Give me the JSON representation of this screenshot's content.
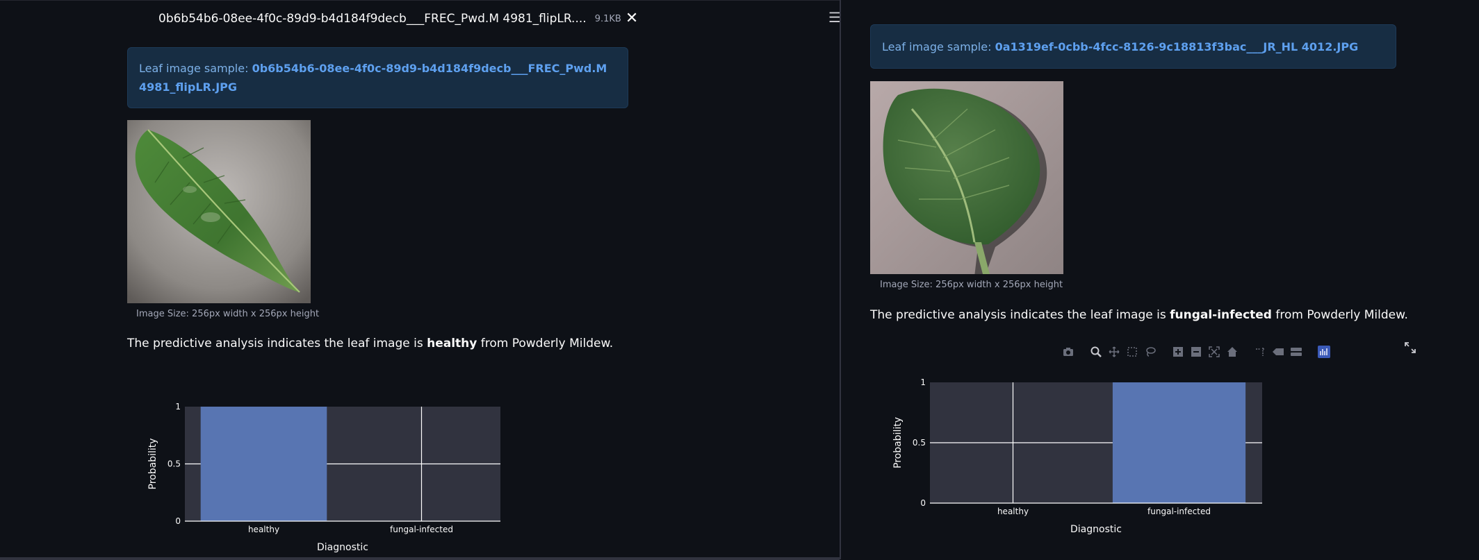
{
  "left_pane": {
    "file": {
      "name": "0b6b54b6-08ee-4f0c-89d9-b4d184f9decb___FREC_Pwd.M 4981_flipLR....",
      "size": "9.1KB",
      "close_icon": "close-icon",
      "file_icon": "file-icon"
    },
    "menu_icon": "hamburger-menu-icon",
    "info_prefix": "Leaf image sample: ",
    "info_filename": "0b6b54b6-08ee-4f0c-89d9-b4d184f9decb___FREC_Pwd.M 4981_flipLR.JPG",
    "image_caption": "Image Size: 256px width x 256px height",
    "analysis": {
      "prefix": "The predictive analysis indicates the leaf image is ",
      "result": "healthy",
      "suffix": " from Powderly Mildew."
    }
  },
  "right_pane": {
    "info_prefix": "Leaf image sample: ",
    "info_filename": "0a1319ef-0cbb-4fcc-8126-9c18813f3bac___JR_HL 4012.JPG",
    "image_caption": "Image Size: 256px width x 256px height",
    "analysis": {
      "prefix": "The predictive analysis indicates the leaf image is ",
      "result": "fungal-infected",
      "suffix": " from Powderly Mildew."
    },
    "modebar_icons": [
      "camera-icon",
      "zoom-icon",
      "pan-icon",
      "box-select-icon",
      "lasso-select-icon",
      "zoom-in-icon",
      "zoom-out-icon",
      "autoscale-icon",
      "reset-axes-icon",
      "spike-lines-icon",
      "hover-closest-icon",
      "hover-compare-icon",
      "plotly-logo-icon"
    ],
    "expand_icon": "fullscreen-icon"
  },
  "colors": {
    "background": "#0e1117",
    "plot_bg": "#31333f",
    "bar": "#5875b2",
    "info_bg": "#172d43",
    "info_link": "#5ea0ef"
  },
  "chart_data": [
    {
      "type": "bar",
      "categories": [
        "healthy",
        "fungal-infected"
      ],
      "values": [
        1,
        0
      ],
      "xlabel": "Diagnostic",
      "ylabel": "Probability",
      "yticks": [
        "0",
        "0.5",
        "1"
      ],
      "ylim": [
        0,
        1
      ],
      "grid": true
    },
    {
      "type": "bar",
      "categories": [
        "healthy",
        "fungal-infected"
      ],
      "values": [
        0,
        1
      ],
      "xlabel": "Diagnostic",
      "ylabel": "Probability",
      "yticks": [
        "0",
        "0.5",
        "1"
      ],
      "ylim": [
        0,
        1
      ],
      "grid": true
    }
  ]
}
